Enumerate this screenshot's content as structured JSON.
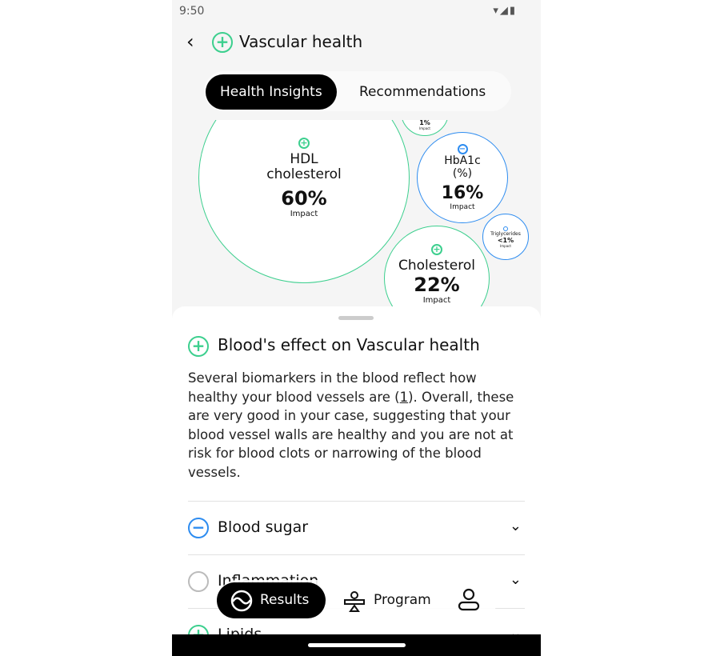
{
  "status": {
    "time": "9:50",
    "icons": "▾◢▮"
  },
  "header": {
    "title": "Vascular health"
  },
  "tabs": [
    {
      "label": "Health Insights",
      "active": true
    },
    {
      "label": "Recommendations",
      "active": false
    }
  ],
  "bubbles": [
    {
      "name": "HDL cholesterol",
      "value": "60%",
      "caption": "Impact",
      "effect": "positive"
    },
    {
      "name": "",
      "value": "1%",
      "caption": "Impact",
      "effect": "positive"
    },
    {
      "name": "HbA1c (%)",
      "value": "16%",
      "caption": "Impact",
      "effect": "negative"
    },
    {
      "name": "Triglycerides",
      "value": "<1%",
      "caption": "Impact",
      "effect": "negative"
    },
    {
      "name": "Cholesterol",
      "value": "22%",
      "caption": "Impact",
      "effect": "positive"
    }
  ],
  "sheet": {
    "title": "Blood's effect on Vascular health",
    "para_before": "Several biomarkers in the blood reflect how healthy your blood vessels are (",
    "ref": "1",
    "para_after": "). Overall, these are very good in your case, suggesting that your blood vessel walls are healthy and you are not at risk for blood clots or narrowing of the blood vessels.",
    "rows": [
      {
        "label": "Blood sugar",
        "status": "negative"
      },
      {
        "label": "Inflammation",
        "status": "neutral"
      },
      {
        "label": "Lipids",
        "status": "positive"
      }
    ]
  },
  "nav": {
    "results": "Results",
    "program": "Program"
  },
  "colors": {
    "positive": "#3ccf8e",
    "negative": "#2d8cf0",
    "neutral": "#bbbbbb"
  }
}
